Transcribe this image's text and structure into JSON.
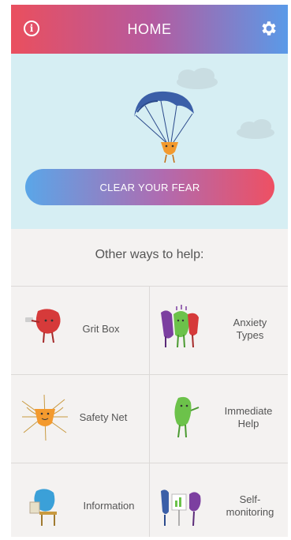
{
  "header": {
    "title": "HOME",
    "info_icon": "info-circle-icon",
    "settings_icon": "gear-icon",
    "gradient_left": "#ea4f5e",
    "gradient_right": "#5a9ae8"
  },
  "hero": {
    "button_label": "CLEAR YOUR FEAR",
    "background": "#d6eef3"
  },
  "other_ways": {
    "title": "Other ways to help:",
    "items": [
      {
        "label": "Grit Box",
        "icon": "red-character-icon"
      },
      {
        "label": "Anxiety Types",
        "label_line1": "Anxiety",
        "label_line2": "Types",
        "icon": "anxiety-characters-icon"
      },
      {
        "label": "Safety Net",
        "icon": "safety-net-icon"
      },
      {
        "label": "Immediate Help",
        "label_line1": "Immediate",
        "label_line2": "Help",
        "icon": "green-character-icon"
      },
      {
        "label": "Information",
        "icon": "blue-character-reading-icon"
      },
      {
        "label": "Self-monitoring",
        "label_line1": "Self-",
        "label_line2": "monitoring",
        "icon": "monitoring-characters-icon"
      }
    ]
  }
}
